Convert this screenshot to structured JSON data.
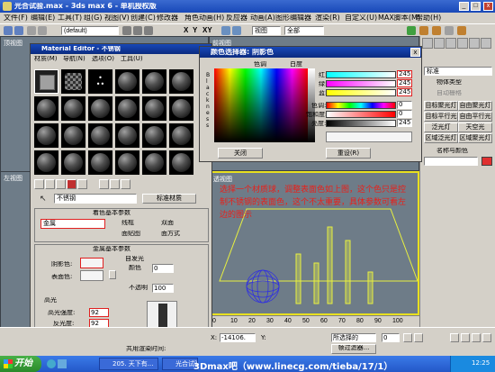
{
  "app": {
    "title": "光合试验.max - 3ds max 6 - 单机授权版"
  },
  "menu": [
    "文件(F)",
    "编辑(E)",
    "工具(T)",
    "组(G)",
    "视图(V)",
    "创建(C)",
    "修改器",
    "角色动画(H)",
    "反应器",
    "动画(A)",
    "图形编辑器",
    "渲染(R)",
    "自定义(U)",
    "MAX脚本(M)",
    "帮助(H)"
  ],
  "toolbar": {
    "undo_label": "撤",
    "selection_set": "(default)",
    "filter": "全部",
    "view_label": "视图",
    "axis_x": "X",
    "axis_y": "Y",
    "axis_xy": "XY"
  },
  "viewports": {
    "top_left": "顶视图",
    "top_right": "前视图",
    "bottom_left": "左视图",
    "perspective": "透视图",
    "ruler": [
      "0",
      "10",
      "20",
      "30",
      "40",
      "50",
      "60",
      "70",
      "80",
      "90",
      "100"
    ]
  },
  "material_editor": {
    "title": "Material Editor - 不锈钢",
    "menu": [
      "材质(M)",
      "导航(N)",
      "选项(O)",
      "工具(U)"
    ],
    "material_name": "不锈钢",
    "material_type": "标准材质",
    "rollout_shader": "着色基本参数",
    "shader": "金属",
    "wire": "线框",
    "two_sided": "双面",
    "face_map": "面贴图",
    "faceted": "面方式",
    "rollout_metal": "金属基本参数",
    "ambient": "阴影色:",
    "diffuse": "表面色:",
    "self_illum": "自发光",
    "color_label": "颜色",
    "self_illum_value": "0",
    "opacity_label": "不透明",
    "opacity_value": "100",
    "specular_group": "高光",
    "spec_level_label": "高光强度:",
    "spec_level": "92",
    "glossiness_label": "反光度:",
    "glossiness": "92"
  },
  "color_selector": {
    "title": "颜色选择器: 阴影色",
    "hue_label": "色调",
    "whiteness_label": "白度",
    "blackness_label": "B l a c k n e s s",
    "red_label": "红:",
    "green_label": "绿:",
    "blue_label": "蓝:",
    "red": "245",
    "green": "245",
    "blue": "245",
    "hue2_label": "色调:",
    "sat_label": "饱和度:",
    "val_label": "亮度:",
    "hue": "0",
    "sat": "0",
    "val": "245",
    "close_button": "关闭",
    "reset_button": "重设(R)",
    "ok_button": "确定(O)",
    "cancel_button": "取消"
  },
  "command_panel": {
    "dropdown": "标准",
    "rollout_obj": "物体类型",
    "autogrid": "自动栅格",
    "buttons": [
      "目标聚光灯",
      "目标平行光",
      "泛光灯",
      "天空光",
      "自由聚光灯",
      "自由平行光",
      "区域泛光灯",
      "区域聚光灯"
    ],
    "rollout_name": "名称与颜色"
  },
  "status": {
    "selection": "共用渲染时间:",
    "x_label": "X:",
    "x_value": "-14106.",
    "y_label": "Y:",
    "grid": "所选择的",
    "key_filter": "帧过滤器...",
    "frame": "0",
    "auto_key": "自动关键点"
  },
  "taskbar": {
    "start": "开始",
    "items": [
      "光合试验",
      "205. 天下有..."
    ],
    "watermark": "3Dmax吧（www.linecg.com/tieba/17/1）",
    "clock": "12:25"
  },
  "annotation": "选择一个材质球，调整表面色如上图，这个色只是控制不锈钢的表面色，这个不太重要，具体参数可看左边的图示",
  "colors": {
    "accent": "#1848b8",
    "annotation": "#e8201a",
    "viewport": "#6e7c88",
    "wireframe_sphere": "#3030e0",
    "cylinders": "#e8f040"
  }
}
